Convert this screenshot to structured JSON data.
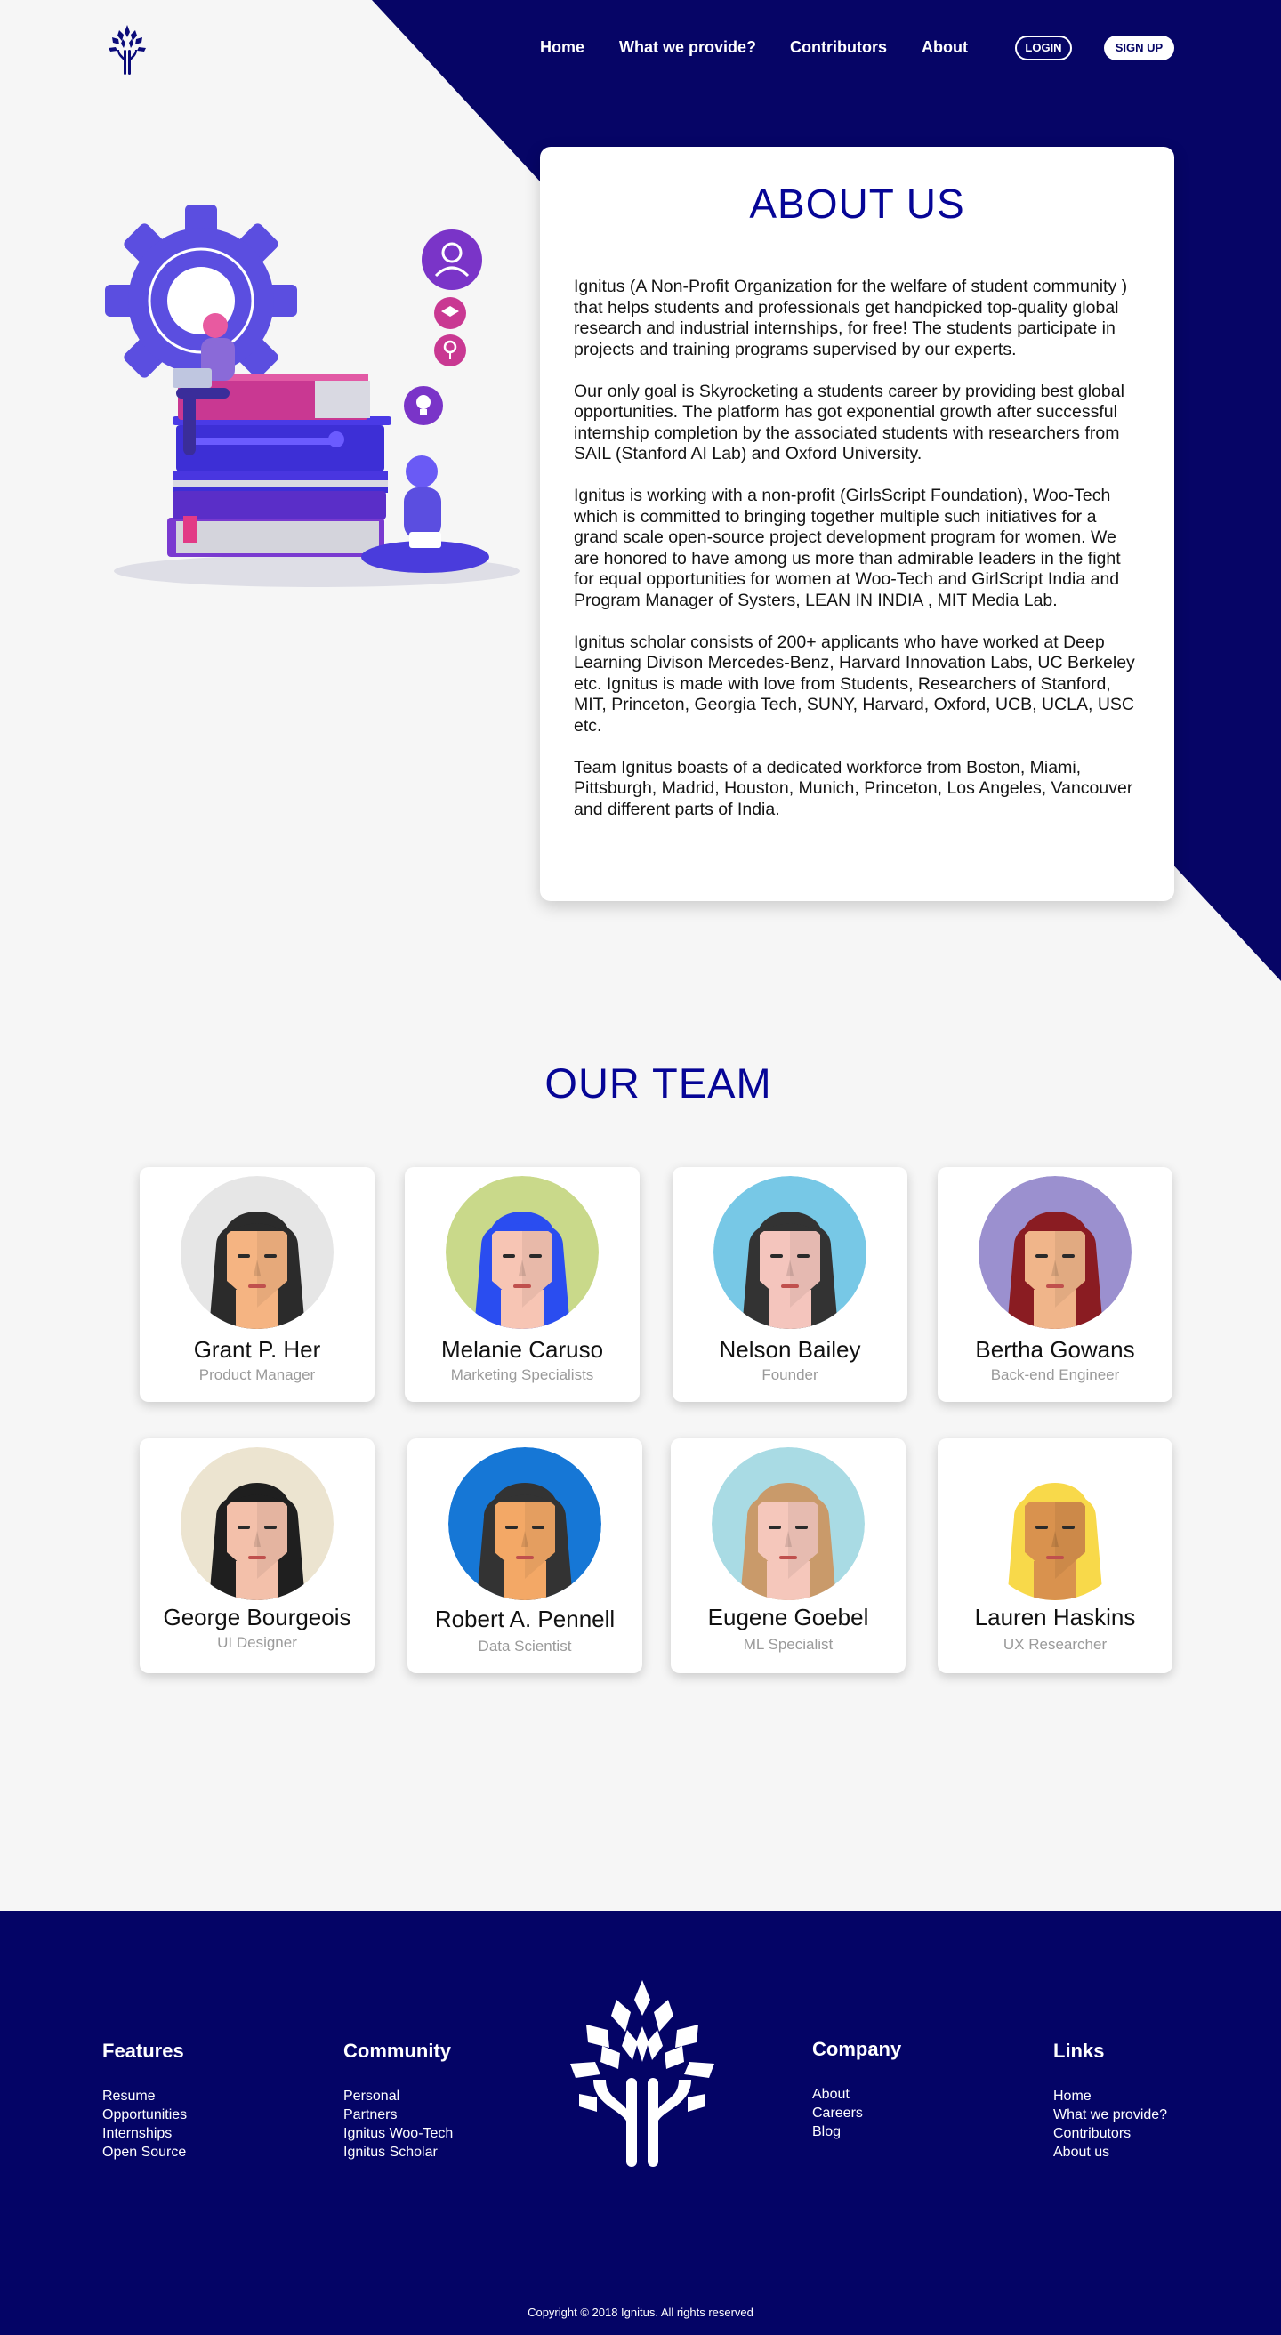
{
  "colors": {
    "primary": "#060566",
    "accent": "#060596",
    "background": "#f6f6f6",
    "card": "#ffffff"
  },
  "nav": {
    "logo_icon": "tree-logo-icon",
    "links": [
      "Home",
      "What we provide?",
      "Contributors",
      "About"
    ],
    "login": "LOGIN",
    "signup": "SIGN UP"
  },
  "about": {
    "title": "ABOUT US",
    "paragraphs": [
      "Ignitus (A Non-Profit Organization for the welfare of student community ) that helps students and professionals get handpicked top-quality global research and industrial internships, for free! The students participate in projects and training programs supervised by our experts.",
      "Our only goal is Skyrocketing a students career by providing best global opportunities. The platform has got exponential growth after successful internship completion by the associated students with researchers from SAIL (Stanford AI Lab) and Oxford University.",
      "Ignitus is working with a non-profit (GirlsScript Foundation), Woo-Tech which is committed to bringing together multiple such initiatives for a grand scale open-source project development program for women. We are honored to have among us more than admirable leaders in the fight for equal opportunities for women at Woo-Tech and GirlScript India and Program Manager of Systers, LEAN IN INDIA , MIT Media Lab.",
      "Ignitus scholar consists of 200+ applicants who have worked at Deep Learning Divison Mercedes-Benz, Harvard Innovation Labs, UC Berkeley etc. Ignitus is made with love from Students, Researchers of Stanford, MIT, Princeton, Georgia Tech, SUNY, Harvard, Oxford, UCB, UCLA, USC etc.",
      "Team Ignitus boasts of a dedicated workforce from Boston, Miami, Pittsburgh, Madrid, Houston, Munich, Princeton, Los Angeles, Vancouver and different parts of India."
    ]
  },
  "team": {
    "title": "OUR TEAM",
    "members": [
      {
        "name": "Grant P. Her",
        "role": "Product Manager",
        "bg": "#e6e6e6",
        "hair": "#2b2b2b",
        "skin": "#f5b482"
      },
      {
        "name": "Melanie Caruso",
        "role": "Marketing Specialists",
        "bg": "#c9d98a",
        "hair": "#2a4df0",
        "skin": "#f7c5b4"
      },
      {
        "name": "Nelson Bailey",
        "role": "Founder",
        "bg": "#77c8e6",
        "hair": "#333333",
        "skin": "#f4c5bd"
      },
      {
        "name": "Bertha Gowans",
        "role": "Back-end Engineer",
        "bg": "#9b90cf",
        "hair": "#8a1c22",
        "skin": "#f0b58a"
      },
      {
        "name": "George Bourgeois",
        "role": "UI Designer",
        "bg": "#ece4d0",
        "hair": "#1f1f1f",
        "skin": "#f3c0aa"
      },
      {
        "name": "Robert A. Pennell",
        "role": "Data Scientist",
        "bg": "#1677d6",
        "hair": "#333333",
        "skin": "#f3a866"
      },
      {
        "name": "Eugene Goebel",
        "role": "ML Specialist",
        "bg": "#a9dbe4",
        "hair": "#c99a6a",
        "skin": "#f5c7bb"
      },
      {
        "name": "Lauren Haskins",
        "role": "UX Researcher",
        "bg": "#ffffff",
        "hair": "#f8d94a",
        "skin": "#d9924e"
      }
    ]
  },
  "footer": {
    "features": {
      "title": "Features",
      "items": [
        "Resume",
        "Opportunities",
        "Internships",
        "Open Source"
      ]
    },
    "community": {
      "title": "Community",
      "items": [
        "Personal",
        "Partners",
        "Ignitus Woo-Tech",
        "Ignitus Scholar"
      ]
    },
    "company": {
      "title": "Company",
      "items": [
        "About",
        "Careers",
        "Blog"
      ]
    },
    "links": {
      "title": "Links",
      "items": [
        "Home",
        "What we provide?",
        "Contributors",
        "About us"
      ]
    },
    "logo_icon": "tree-logo-icon",
    "copyright": "Copyright © 2018 Ignitus. All rights reserved"
  }
}
